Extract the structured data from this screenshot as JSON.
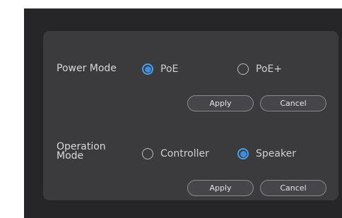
{
  "power_mode": {
    "label": "Power Mode",
    "options": [
      {
        "label": "PoE",
        "checked": true
      },
      {
        "label": "PoE+",
        "checked": false
      }
    ],
    "apply_label": "Apply",
    "cancel_label": "Cancel"
  },
  "operation_mode": {
    "label_line1": "Operation",
    "label_line2": "Mode",
    "options": [
      {
        "label": "Controller",
        "checked": false
      },
      {
        "label": "Speaker",
        "checked": true
      }
    ],
    "apply_label": "Apply",
    "cancel_label": "Cancel"
  },
  "colors": {
    "accent": "#3a8ee0",
    "panel": "#3b3b3e",
    "background": "#262628"
  }
}
